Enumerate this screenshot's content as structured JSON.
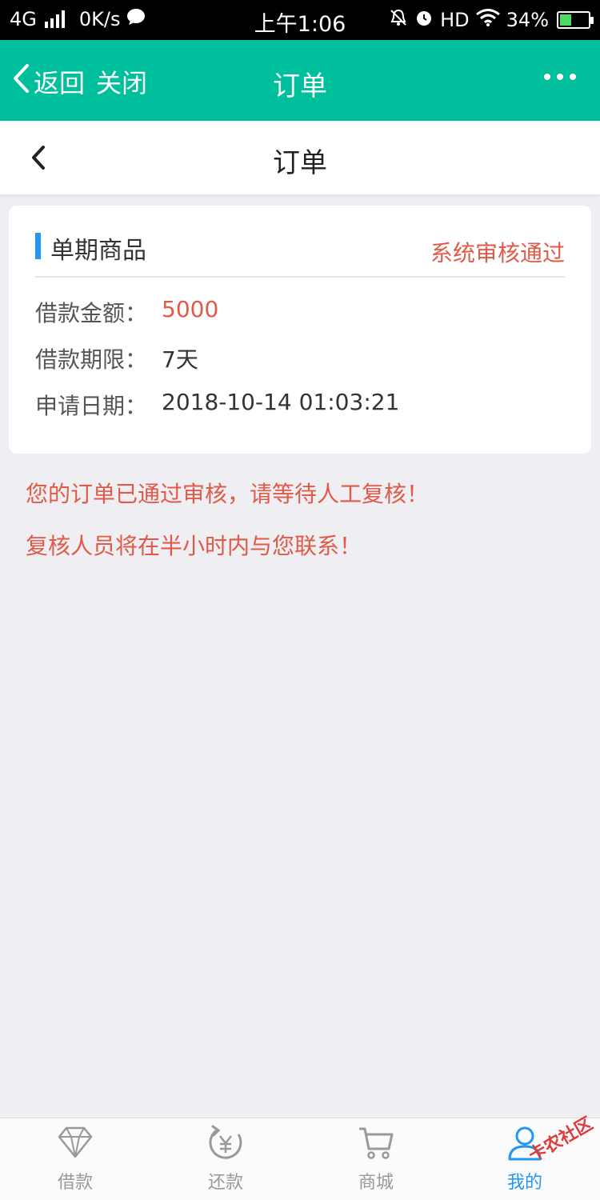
{
  "status_bar": {
    "network": "4G",
    "speed": "0K/s",
    "time": "上午1:06",
    "hd": "HD",
    "battery": "34%"
  },
  "app_bar": {
    "back_label": "返回",
    "close_label": "关闭",
    "title": "订单"
  },
  "page_header": {
    "title": "订单"
  },
  "order": {
    "product_title": "单期商品",
    "status": "系统审核通过",
    "rows": [
      {
        "label": "借款金额：",
        "value": "5000"
      },
      {
        "label": "借款期限：",
        "value": "7天"
      },
      {
        "label": "申请日期：",
        "value": "2018-10-14 01:03:21"
      }
    ]
  },
  "notices": [
    "您的订单已通过审核，请等待人工复核！",
    "复核人员将在半小时内与您联系！"
  ],
  "tabs": [
    {
      "label": "借款",
      "icon": "diamond-icon"
    },
    {
      "label": "还款",
      "icon": "repay-yen-icon"
    },
    {
      "label": "商城",
      "icon": "cart-icon"
    },
    {
      "label": "我的",
      "icon": "user-icon"
    }
  ],
  "watermark": "卡农社区",
  "colors": {
    "accent": "#00bf9c",
    "alert": "#e15a47",
    "active_tab": "#2196f3"
  }
}
